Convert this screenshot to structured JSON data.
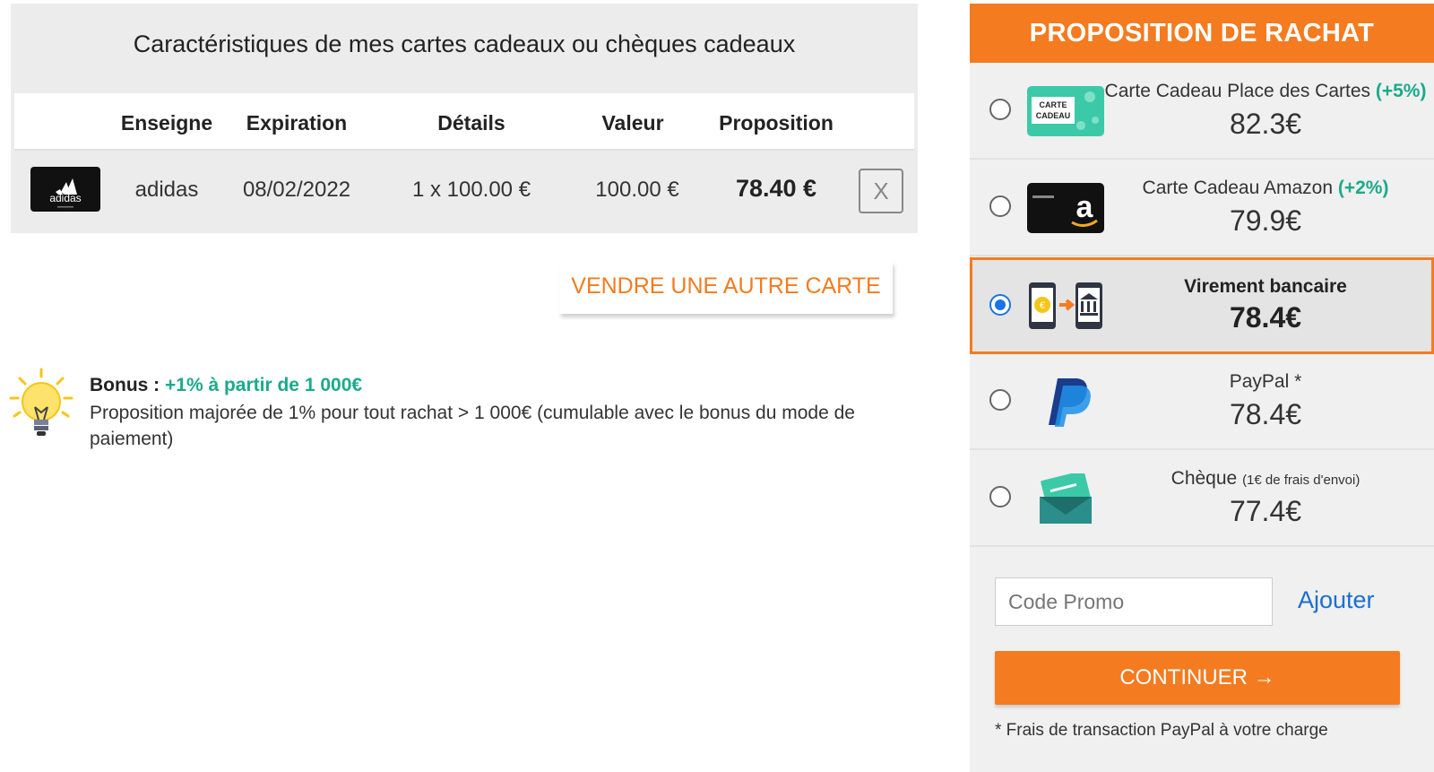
{
  "cards": {
    "title": "Caractéristiques de mes cartes cadeaux ou chèques cadeaux",
    "headers": [
      "Enseigne",
      "Expiration",
      "Détails",
      "Valeur",
      "Proposition"
    ],
    "row": {
      "logo_text": "adidas",
      "brand": "adidas",
      "expiration": "08/02/2022",
      "details": "1 x 100.00 €",
      "value": "100.00 €",
      "proposition": "78.40 €",
      "remove_label": "X"
    },
    "another_label": "VENDRE UNE AUTRE CARTE"
  },
  "bonus": {
    "label": "Bonus : ",
    "highlight": "+1% à partir de 1 000€",
    "text": "Proposition majorée de 1% pour tout rachat > 1 000€ (cumulable avec le bonus du mode de paiement)"
  },
  "offer": {
    "title": "PROPOSITION DE RACHAT",
    "options": [
      {
        "label": "Carte Cadeau Place des Cartes ",
        "bonus": "(+5%)",
        "price": "82.3€",
        "icon": "gift-card-icon",
        "icon_text": "CARTE CADEAU"
      },
      {
        "label": "Carte Cadeau Amazon ",
        "bonus": "(+2%)",
        "price": "79.9€",
        "icon": "amazon-icon",
        "icon_text": "a"
      },
      {
        "label": "Virement bancaire",
        "price": "78.4€",
        "icon": "bank-transfer-icon",
        "selected": true
      },
      {
        "label": "PayPal *",
        "price": "78.4€",
        "icon": "paypal-icon"
      },
      {
        "label": "Chèque ",
        "note": "(1€ de frais d'envoi)",
        "price": "77.4€",
        "icon": "cheque-icon"
      }
    ],
    "promo_placeholder": "Code Promo",
    "promo_add": "Ajouter",
    "continue_label": "CONTINUER →",
    "footnote": "* Frais de transaction PayPal à votre charge"
  },
  "colors": {
    "accent": "#f47b20",
    "green": "#1aaa8c",
    "link": "#1a6fd1"
  }
}
